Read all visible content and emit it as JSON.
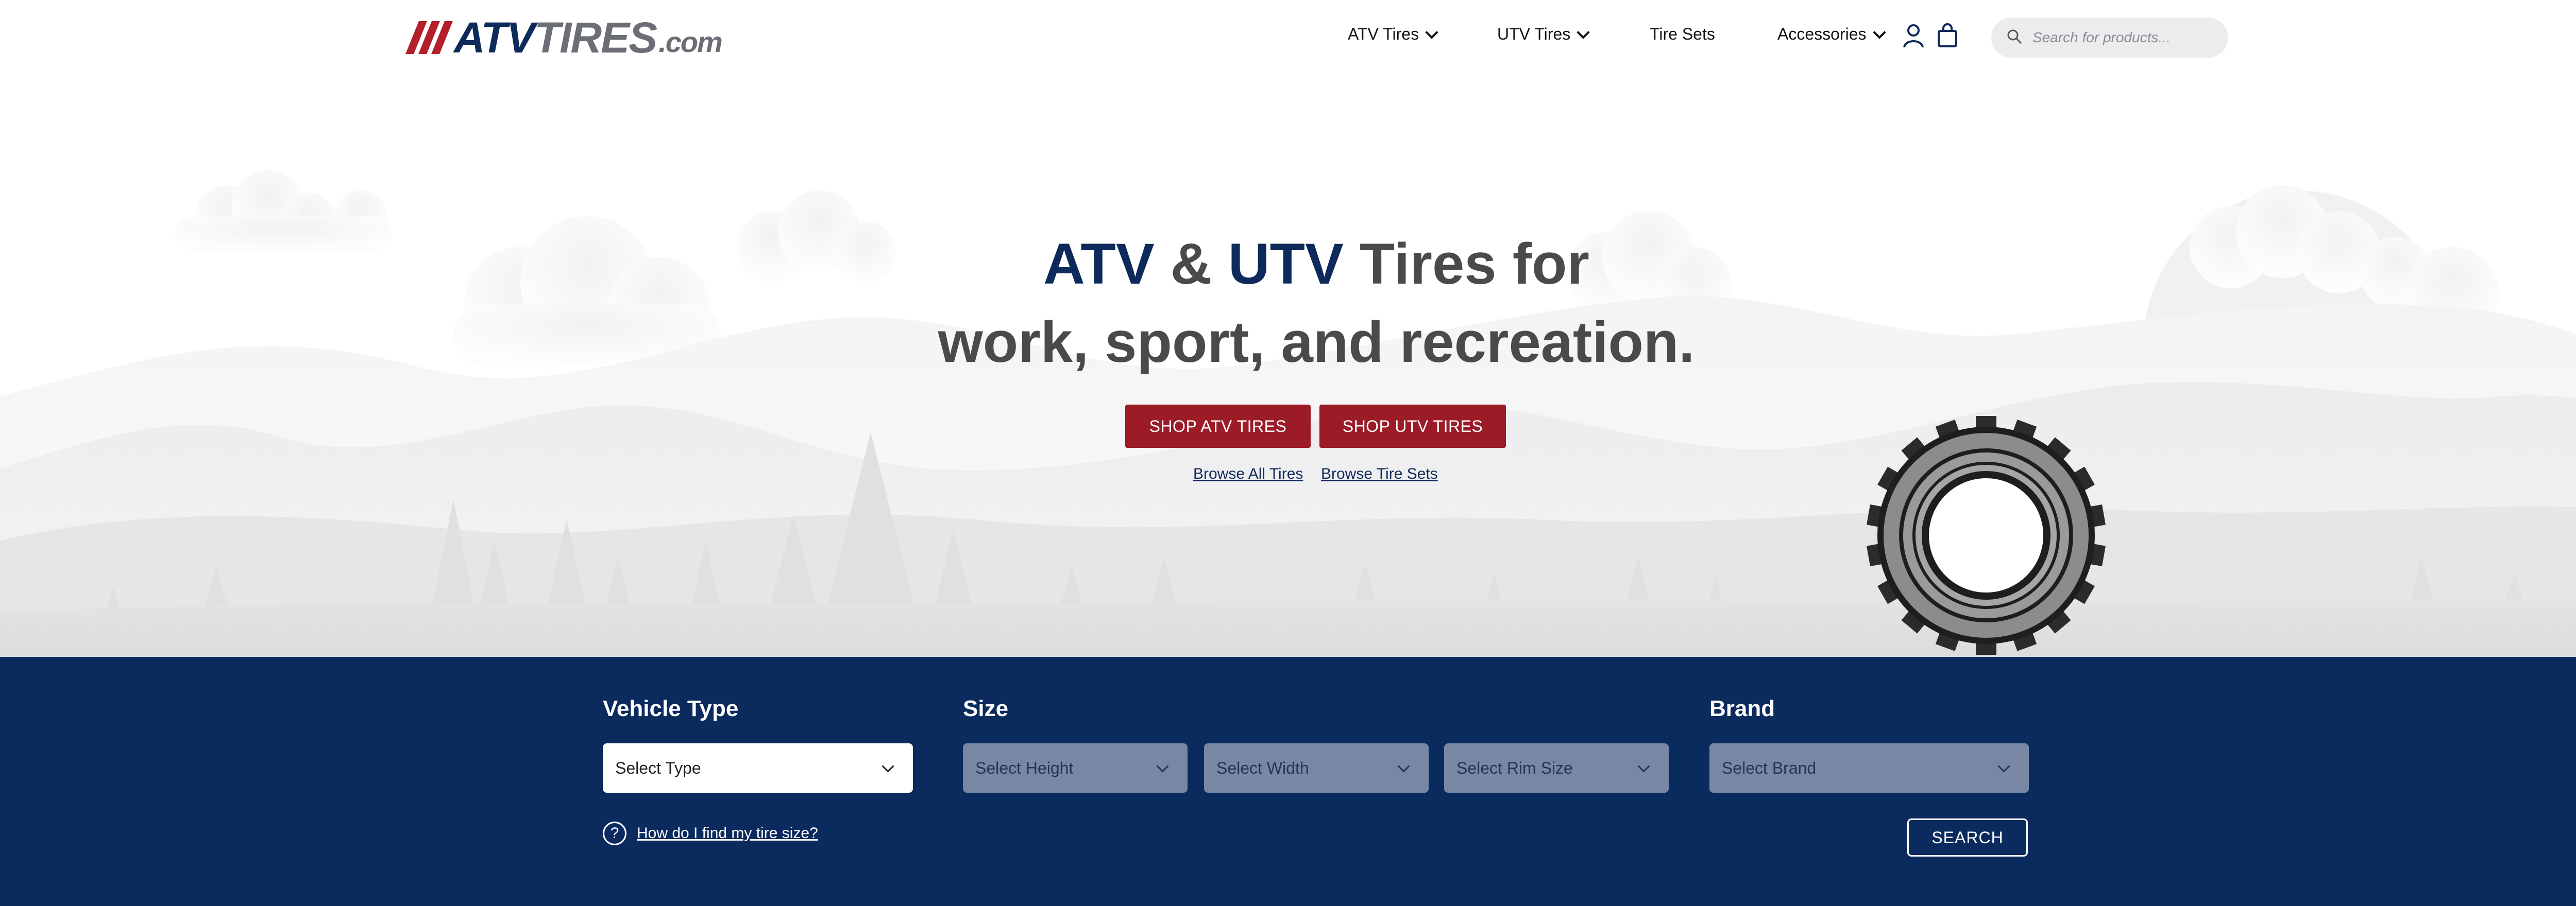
{
  "brand": {
    "logo_atv": "ATV",
    "logo_tires": "TIRES",
    "logo_com": ".com"
  },
  "nav": {
    "items": [
      {
        "label": "ATV Tires",
        "has_dropdown": true
      },
      {
        "label": "UTV Tires",
        "has_dropdown": true
      },
      {
        "label": "Tire Sets",
        "has_dropdown": false
      },
      {
        "label": "Accessories",
        "has_dropdown": true
      }
    ],
    "icons": [
      "user-icon",
      "shopping-bag-icon"
    ],
    "search_placeholder": "Search for products..."
  },
  "hero": {
    "line1_a": "ATV",
    "line1_amp": " & ",
    "line1_b": "UTV",
    "line1_rest": " Tires for",
    "line2": "work, sport, and recreation.",
    "buttons": [
      "SHOP ATV TIRES",
      "SHOP UTV TIRES"
    ],
    "links": [
      "Browse All Tires",
      "Browse Tire Sets"
    ]
  },
  "finder": {
    "vehicle_type_label": "Vehicle Type",
    "size_label": "Size",
    "brand_label": "Brand",
    "select_type": "Select Type",
    "select_height": "Select Height",
    "select_width": "Select Width",
    "select_rim": "Select Rim Size",
    "select_brand": "Select Brand",
    "help_text": "How do I find my tire size?",
    "search_button": "SEARCH"
  },
  "colors": {
    "navy": "#0b2a5e",
    "brand_red": "#9b1b27",
    "text_gray": "#4a4a4a"
  }
}
